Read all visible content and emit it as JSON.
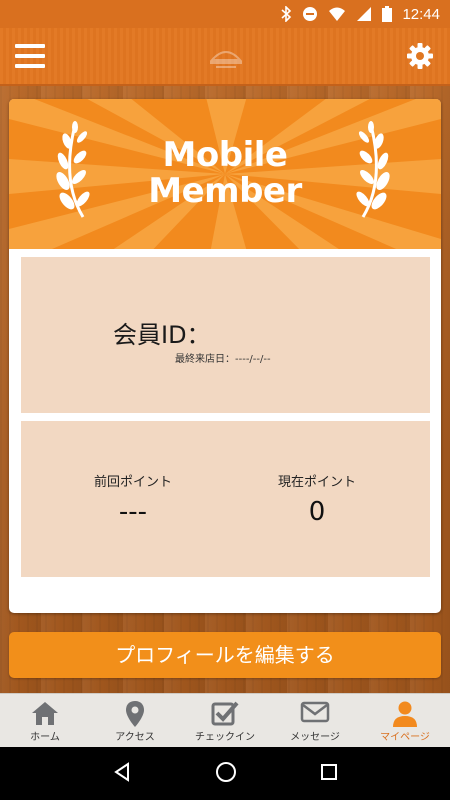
{
  "status_bar": {
    "time": "12:44"
  },
  "app_bar": {
    "menu_icon": "hamburger-menu-icon",
    "logo_icon": "restaurant-logo-icon",
    "settings_icon": "gear-icon"
  },
  "card": {
    "banner_line1": "Mobile",
    "banner_line2": "Member",
    "member_id_label": "会員ID：",
    "last_visit": "最終来店日：----/--/--",
    "previous_points_label": "前回ポイント",
    "previous_points_value": "---",
    "current_points_label": "現在ポイント",
    "current_points_value": "0"
  },
  "edit_profile_label": "プロフィールを編集する",
  "tabs": [
    {
      "label": "ホーム",
      "icon": "home-icon"
    },
    {
      "label": "アクセス",
      "icon": "map-pin-icon"
    },
    {
      "label": "チェックイン",
      "icon": "checkbox-icon"
    },
    {
      "label": "メッセージ",
      "icon": "envelope-icon"
    },
    {
      "label": "マイページ",
      "icon": "person-icon",
      "active": true
    }
  ],
  "colors": {
    "accent": "#f28a1e",
    "panel": "#f2d8c2",
    "active_tab": "#d9701f"
  }
}
